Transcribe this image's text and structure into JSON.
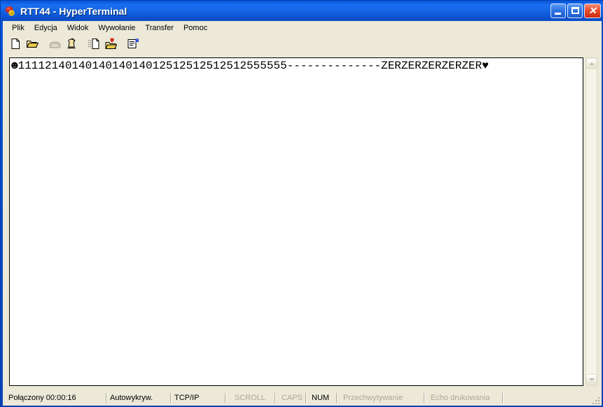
{
  "window": {
    "title": "RTT44 - HyperTerminal",
    "icon": "hyperterminal-icon",
    "controls": [
      {
        "name": "minimize-button",
        "label": ""
      },
      {
        "name": "maximize-button",
        "label": ""
      },
      {
        "name": "close-button",
        "label": "✕"
      }
    ]
  },
  "menu": {
    "items": [
      {
        "label": "Plik"
      },
      {
        "label": "Edycja"
      },
      {
        "label": "Widok"
      },
      {
        "label": "Wywołanie"
      },
      {
        "label": "Transfer"
      },
      {
        "label": "Pomoc"
      }
    ]
  },
  "toolbar": {
    "buttons": [
      {
        "name": "new-connection-button",
        "icon": "new-document-icon",
        "enabled": true
      },
      {
        "name": "open-connection-button",
        "icon": "open-folder-icon",
        "enabled": true
      },
      {
        "name": "disconnect-button",
        "icon": "phone-hangup-icon",
        "enabled": false
      },
      {
        "name": "call-button",
        "icon": "phone-call-icon",
        "enabled": true
      },
      {
        "name": "send-file-button",
        "icon": "send-file-icon",
        "enabled": true
      },
      {
        "name": "receive-file-button",
        "icon": "receive-file-icon",
        "enabled": true
      },
      {
        "name": "properties-button",
        "icon": "properties-icon",
        "enabled": true
      }
    ]
  },
  "terminal": {
    "line": "☻1111214014014014014012512512512512555555--------------ZERZERZERZERZER♥"
  },
  "scrollbar": {
    "up_arrow": "scroll-up-icon",
    "down_arrow": "scroll-down-icon"
  },
  "statusbar": {
    "connected": "Połączony 00:00:16",
    "detect": "Autowykryw.",
    "protocol": "TCP/IP",
    "scroll": "SCROLL",
    "caps": "CAPS",
    "num": "NUM",
    "capture": "Przechwytywanie",
    "print_echo": "Echo drukowania"
  },
  "colors": {
    "title_blue": "#0b57d8",
    "face": "#ece9d8",
    "terminal_bg": "#ffffff",
    "terminal_fg": "#000000",
    "disabled_text": "#aca899",
    "close_red": "#ea5030"
  }
}
